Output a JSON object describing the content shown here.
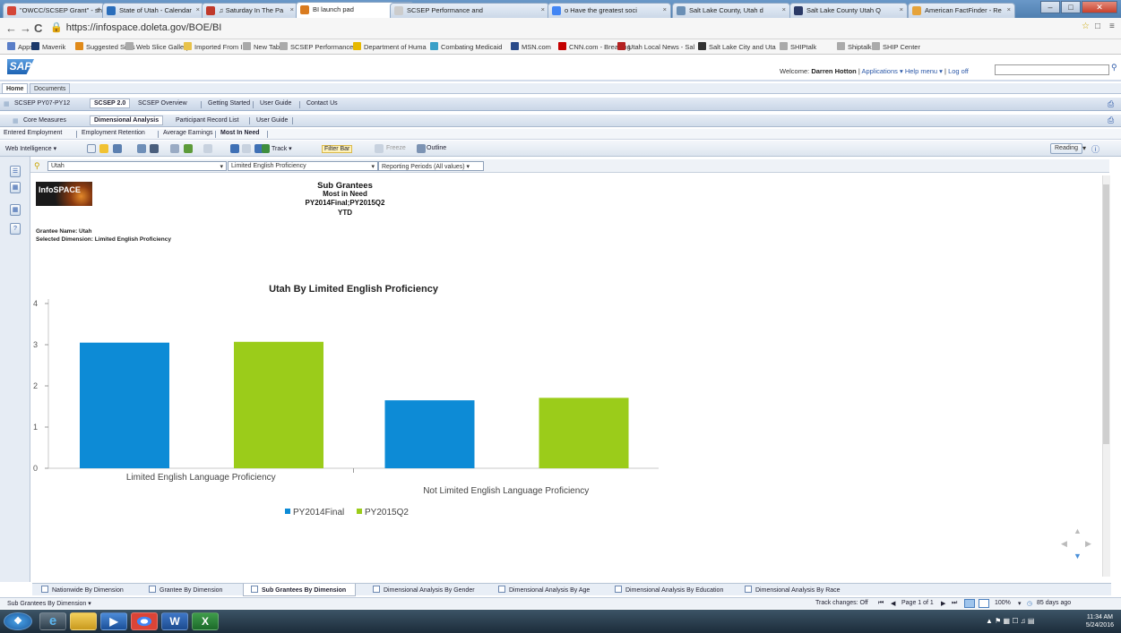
{
  "browser": {
    "tabs": [
      {
        "label": "\"OWCC/SCSEP Grant\" - sh",
        "color": "#d44638"
      },
      {
        "label": "State of Utah - Calendar",
        "color": "#2a6ebb"
      },
      {
        "label": "♫ Saturday In The Pa",
        "color": "#c0392b"
      },
      {
        "label": "BI launch pad",
        "color": "#d97b1f"
      },
      {
        "label": "SCSEP Performance and",
        "color": "#cccccc"
      },
      {
        "label": "o Have the greatest soci",
        "color": "#4285f4"
      },
      {
        "label": "Salt Lake County, Utah d",
        "color": "#6a8fb5"
      },
      {
        "label": "Salt Lake County Utah Q",
        "color": "#2b3a67"
      },
      {
        "label": "American FactFinder - Re",
        "color": "#e6a33a"
      }
    ],
    "url": "https://infospace.doleta.gov/BOE/BI",
    "bookmarks": [
      "Apps",
      "Maverik",
      "Suggested Sites",
      "Web Slice Gallery",
      "Imported From IE",
      "New Tab",
      "SCSEP Performance A",
      "Department of Huma",
      "Combating Medicaid",
      "MSN.com",
      "CNN.com - Breaking",
      "Utah Local News - Sal",
      "Salt Lake City and Uta",
      "SHIPtalk",
      "Shiptalk",
      "SHIP Center"
    ]
  },
  "sap": {
    "logo": "SAP",
    "welcome_prefix": "Welcome:",
    "user": "Darren Hotton",
    "applications": "Applications ▾",
    "help_menu": "Help menu ▾",
    "log_off": "Log off",
    "home_tabs": [
      "Home",
      "Documents"
    ]
  },
  "nav": {
    "level1": [
      "SCSEP PY07-PY12",
      "SCSEP 2.0",
      "SCSEP Overview",
      "Getting Started",
      "User Guide",
      "Contact Us"
    ],
    "level2": [
      "Core Measures",
      "Dimensional Analysis",
      "Participant Record List",
      "User Guide"
    ],
    "level3": [
      "Entered Employment",
      "Employment Retention",
      "Average Earnings",
      "Most In Need"
    ]
  },
  "toolbar": {
    "web_intelligence": "Web Intelligence ▾",
    "track": "Track ▾",
    "filter_bar": "Filter Bar",
    "freeze": "Freeze",
    "outline": "Outline",
    "reading": "Reading"
  },
  "filters": {
    "grantee": "Utah",
    "dimension": "Limited English Proficiency",
    "periods": "Reporting Periods (All values) ▾"
  },
  "report": {
    "logo_text": "InfoSPACE",
    "title": "Sub Grantees",
    "subtitle": "Most in Need",
    "periods": "PY2014Final;PY2015Q2",
    "ytd": "YTD",
    "grantee_name": "Grantee Name: Utah",
    "selected_dimension": "Selected Dimension: Limited English Proficiency"
  },
  "chart_data": {
    "type": "bar",
    "title": "Utah By Limited English Proficiency",
    "categories": [
      "Limited English Language Proficiency",
      "Not Limited English Language Proficiency"
    ],
    "series": [
      {
        "name": "PY2014Final",
        "color": "#0d8bd6",
        "values": [
          3.05,
          1.65
        ]
      },
      {
        "name": "PY2015Q2",
        "color": "#9bcc1a",
        "values": [
          3.07,
          1.71
        ]
      }
    ],
    "ylim": [
      0,
      4
    ],
    "yticks": [
      "0",
      "1",
      "2",
      "3",
      "4"
    ],
    "grid": false,
    "legend": "bottom"
  },
  "report_tabs": [
    "Nationwide By Dimension",
    "Grantee By Dimension",
    "Sub Grantees By Dimension",
    "Dimensional Analysis By Gender",
    "Dimensional Analysis By Age",
    "Dimensional Analysis By Education",
    "Dimensional Analysis By Race"
  ],
  "status": {
    "current_report": "Sub Grantees By Dimension ▾",
    "track_changes": "Track changes: Off",
    "page": "Page 1 of 1",
    "zoom": "100%",
    "age": "85 days ago"
  },
  "taskbar": {
    "time": "11:34 AM",
    "date": "5/24/2016"
  }
}
